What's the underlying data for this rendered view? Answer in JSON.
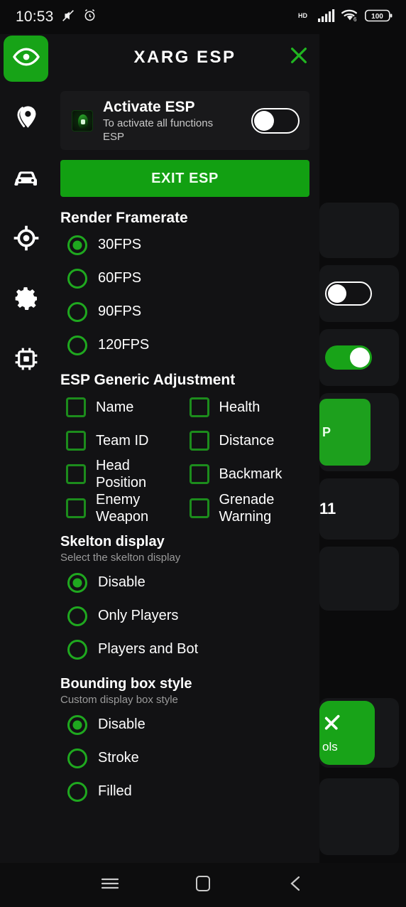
{
  "status_bar": {
    "time": "10:53",
    "icons_left": [
      "mute-icon",
      "alarm-icon"
    ],
    "icons_right": [
      "hd-icon",
      "signal-icon",
      "wifi-icon",
      "battery-icon"
    ],
    "battery_level": "100",
    "network_label": "HD",
    "wifi_generation": "6"
  },
  "header": {
    "title": "XARG ESP",
    "close_label": "close",
    "accent_color": "#17a317"
  },
  "rail": {
    "items": [
      {
        "name": "esp",
        "icon": "eye-icon",
        "active": true
      },
      {
        "name": "location",
        "icon": "location-pin-icon",
        "active": false
      },
      {
        "name": "vehicle",
        "icon": "car-icon",
        "active": false
      },
      {
        "name": "aim",
        "icon": "crosshair-icon",
        "active": false
      },
      {
        "name": "settings",
        "icon": "gear-icon",
        "active": false
      },
      {
        "name": "memory",
        "icon": "chip-icon",
        "active": false
      }
    ]
  },
  "activate_card": {
    "title": "Activate ESP",
    "subtitle": "To activate all functions ESP",
    "toggle_state": "off",
    "logo_icon": "app-logo-icon"
  },
  "exit_button": {
    "label": "EXIT ESP"
  },
  "render_framerate": {
    "title": "Render Framerate",
    "selected": "30FPS",
    "options": [
      {
        "label": "30FPS",
        "selected": true
      },
      {
        "label": "60FPS",
        "selected": false
      },
      {
        "label": "90FPS",
        "selected": false
      },
      {
        "label": "120FPS",
        "selected": false
      }
    ]
  },
  "esp_generic_adjustment": {
    "title": "ESP Generic Adjustment",
    "options": [
      {
        "label": "Name",
        "checked": false
      },
      {
        "label": "Health",
        "checked": false
      },
      {
        "label": "Team ID",
        "checked": false
      },
      {
        "label": "Distance",
        "checked": false
      },
      {
        "label": "Head Position",
        "checked": false
      },
      {
        "label": "Backmark",
        "checked": false
      },
      {
        "label": "Enemy Weapon",
        "checked": false
      },
      {
        "label": "Grenade Warning",
        "checked": false
      }
    ]
  },
  "skelton_display": {
    "title": "Skelton display",
    "subtitle": "Select the skelton display",
    "selected": "Disable",
    "options": [
      {
        "label": "Disable",
        "selected": true
      },
      {
        "label": "Only Players",
        "selected": false
      },
      {
        "label": "Players and Bot",
        "selected": false
      }
    ]
  },
  "bounding_box_style": {
    "title": "Bounding box style",
    "subtitle": "Custom display box style",
    "selected": "Disable",
    "options": [
      {
        "label": "Disable",
        "selected": true
      },
      {
        "label": "Stroke",
        "selected": false
      },
      {
        "label": "Filled",
        "selected": false
      }
    ]
  },
  "background_panel": {
    "partial_button_text": "P",
    "partial_value_text": "11",
    "tile_label": "ols",
    "toggles": [
      {
        "state": "off"
      },
      {
        "state": "on"
      }
    ]
  },
  "nav_bar": {
    "recents_label": "recents",
    "home_label": "home",
    "back_label": "back"
  }
}
